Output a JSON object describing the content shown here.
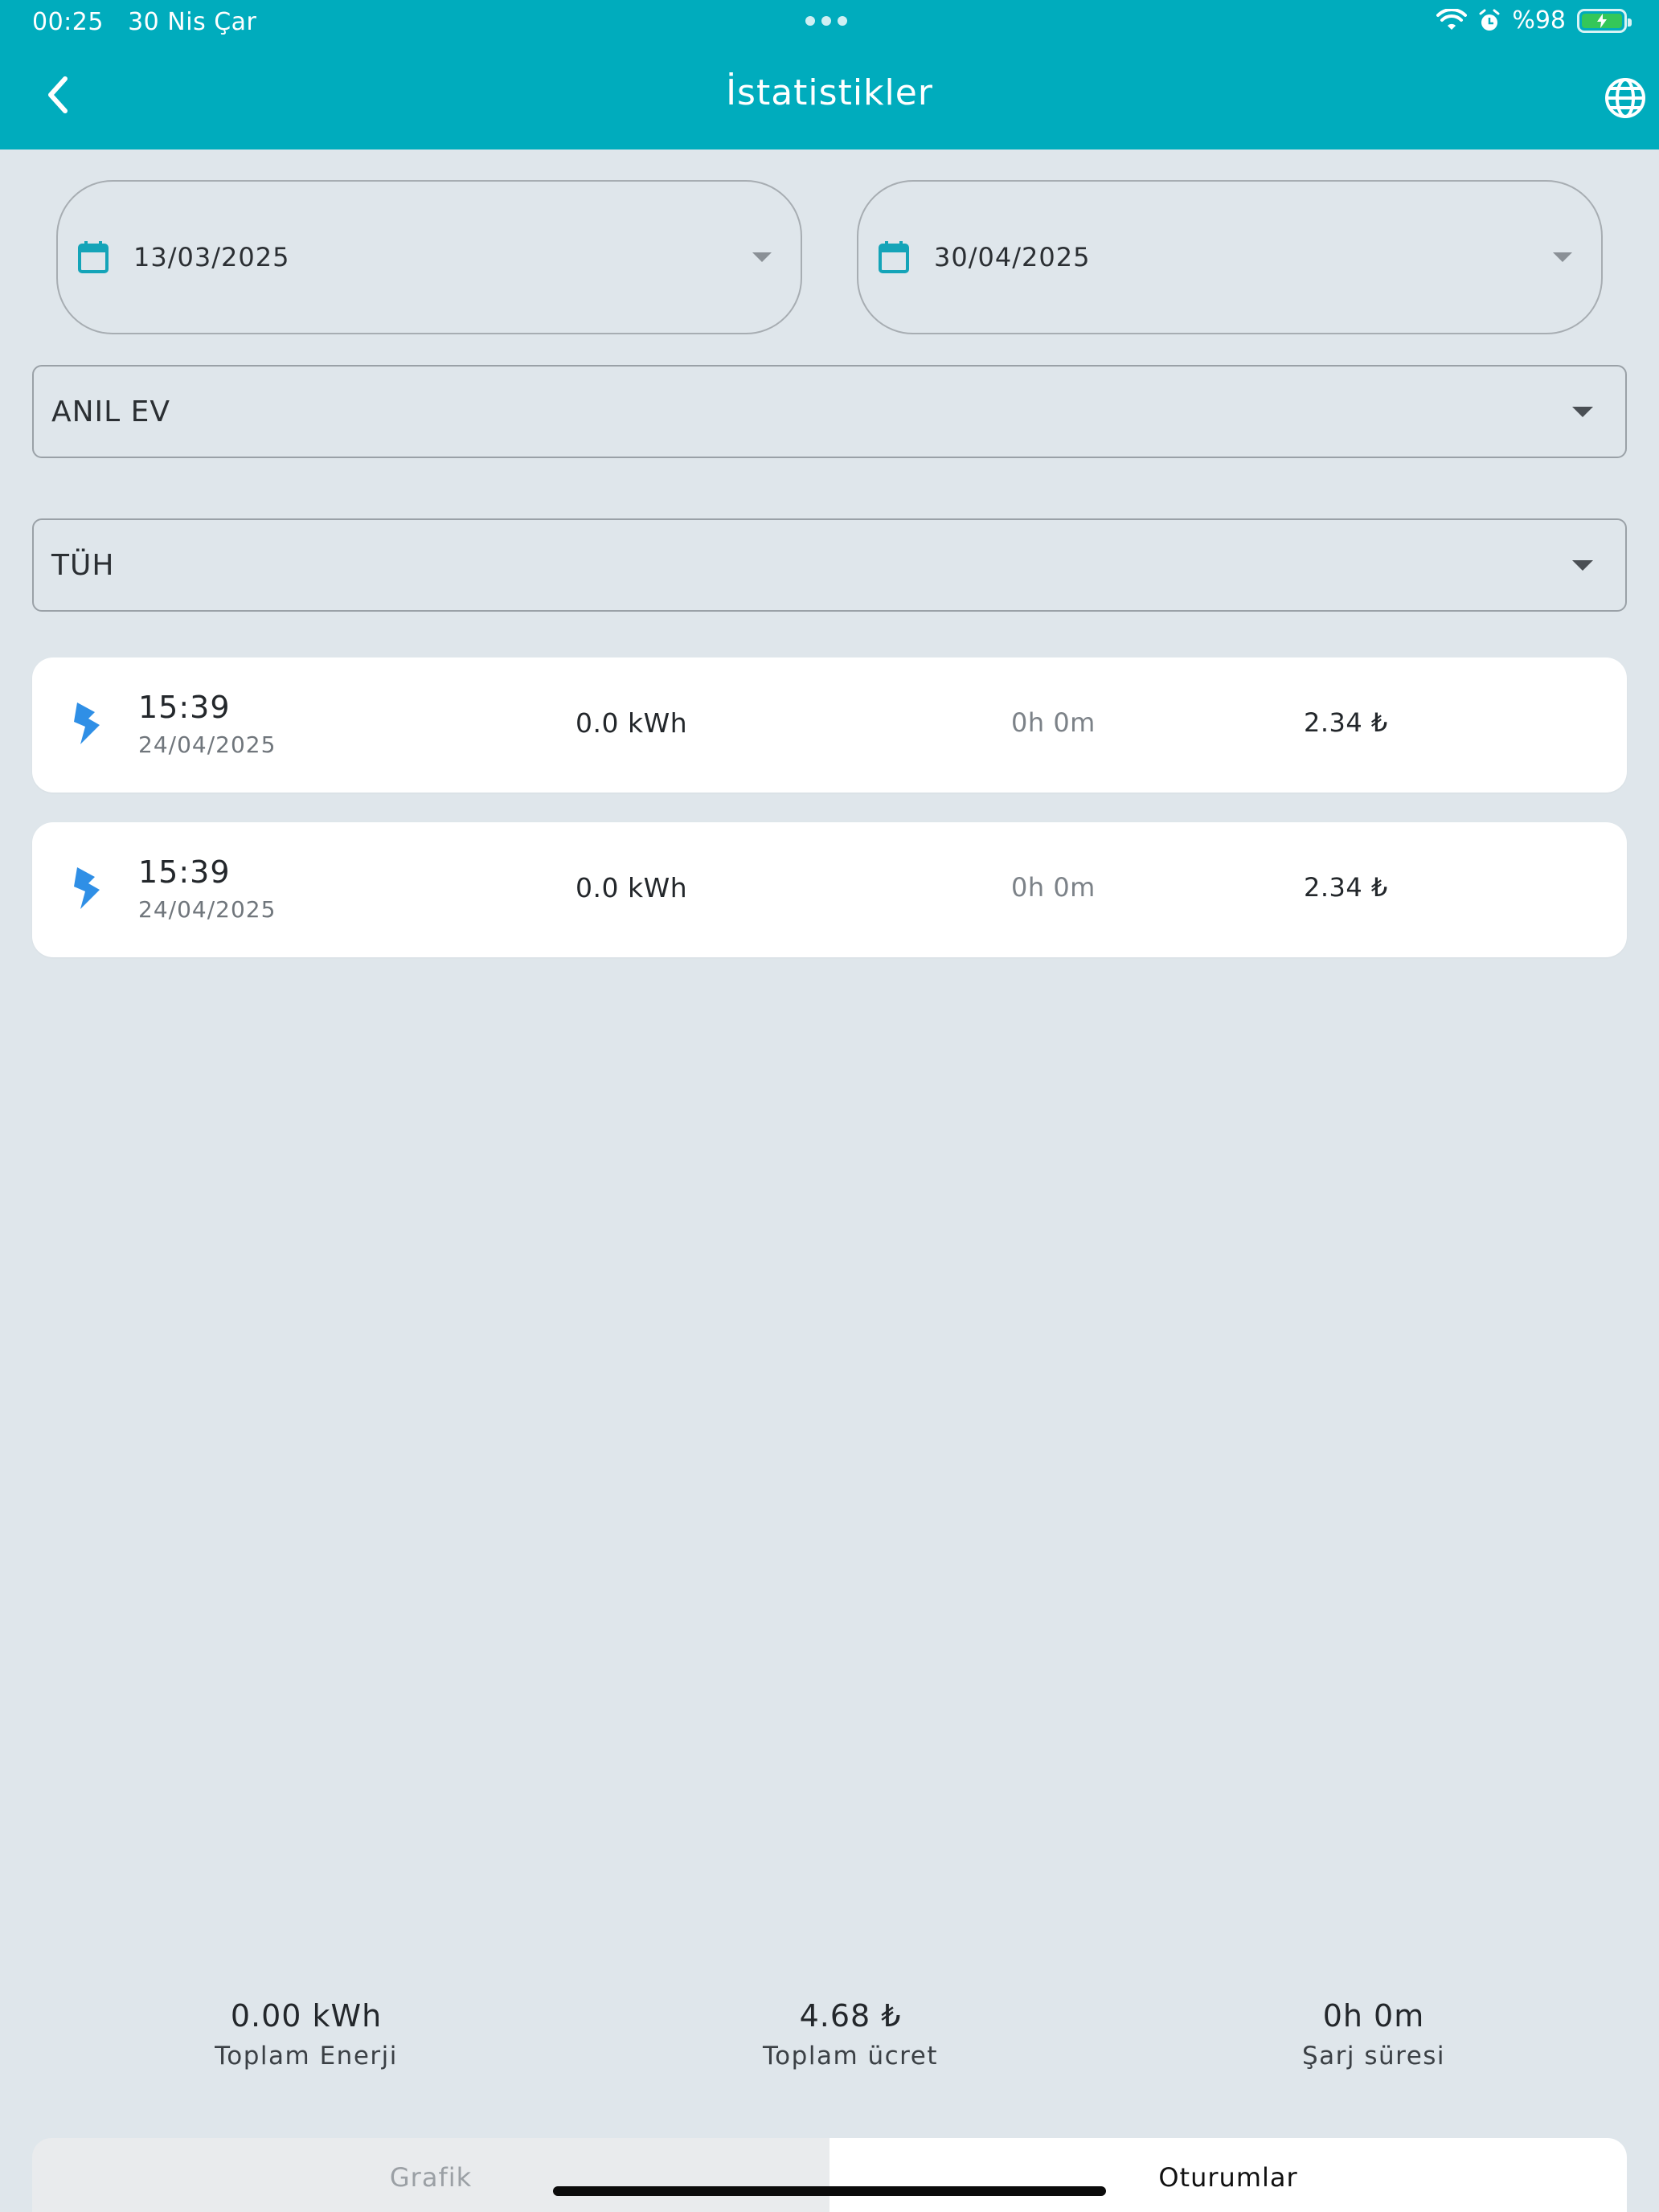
{
  "status_bar": {
    "time": "00:25",
    "date": "30 Nis Çar",
    "battery": "%98"
  },
  "app_bar": {
    "title": "İstatistikler",
    "back_icon": "chevron-left-icon",
    "language_icon": "globe-icon"
  },
  "filters": {
    "start_date": "13/03/2025",
    "end_date": "30/04/2025",
    "location": "ANIL EV",
    "charger": "TÜH"
  },
  "sessions": [
    {
      "time": "15:39",
      "date": "24/04/2025",
      "energy": "0.0 kWh",
      "duration": "0h 0m",
      "price": "2.34 ₺"
    },
    {
      "time": "15:39",
      "date": "24/04/2025",
      "energy": "0.0 kWh",
      "duration": "0h 0m",
      "price": "2.34 ₺"
    }
  ],
  "totals": {
    "energy_value": "0.00 kWh",
    "energy_label": "Toplam Enerji",
    "cost_value": "4.68 ₺",
    "cost_label": "Toplam ücret",
    "duration_value": "0h 0m",
    "duration_label": "Şarj süresi"
  },
  "tabs": [
    {
      "label": "Grafik",
      "active": false
    },
    {
      "label": "Oturumlar",
      "active": true
    }
  ],
  "colors": {
    "accent": "#00acbd",
    "background": "#dfe6eb",
    "bolt": "#2f8fe6"
  }
}
